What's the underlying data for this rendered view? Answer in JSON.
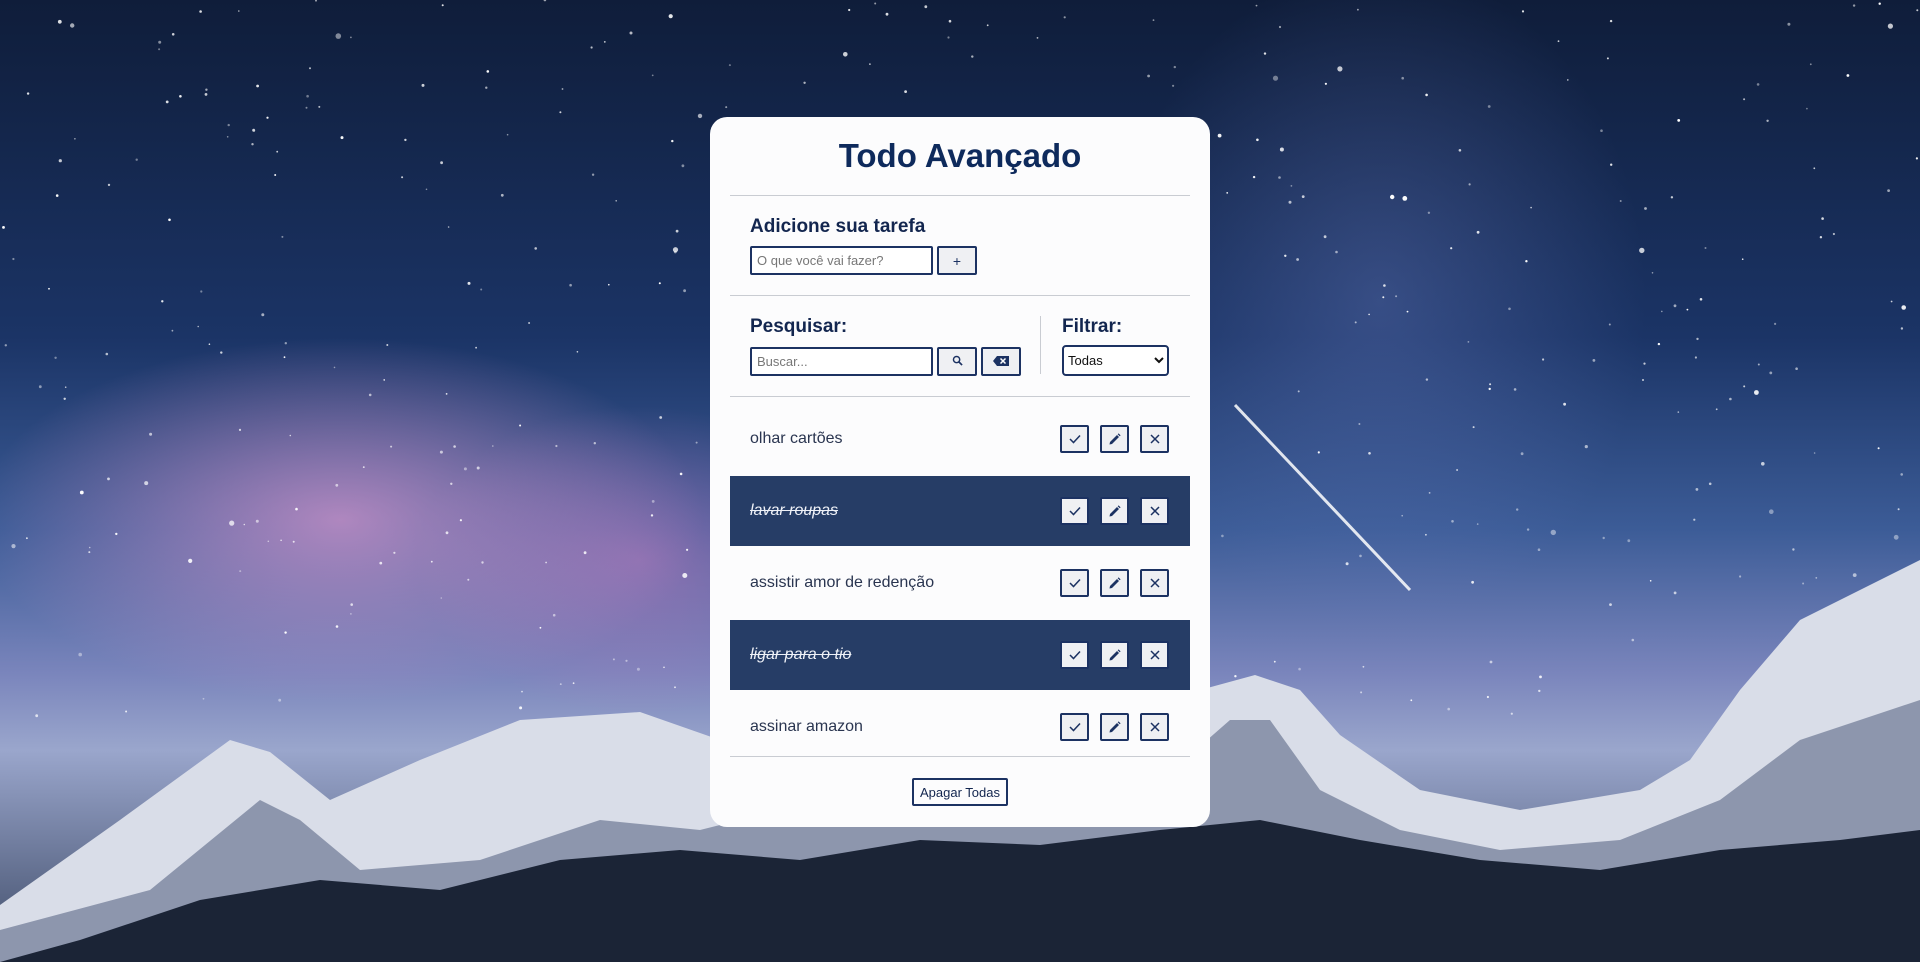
{
  "app": {
    "title": "Todo Avançado"
  },
  "add": {
    "label": "Adicione sua tarefa",
    "input_value": "",
    "input_placeholder": "O que você vai fazer?",
    "add_button_label": "+"
  },
  "search": {
    "label": "Pesquisar:",
    "input_value": "",
    "input_placeholder": "Buscar...",
    "search_icon": "search-icon",
    "clear_icon": "backspace-icon"
  },
  "filter": {
    "label": "Filtrar:",
    "selected": "Todas"
  },
  "todos": [
    {
      "text": "olhar cartões",
      "done": false
    },
    {
      "text": "lavar roupas",
      "done": true
    },
    {
      "text": "assistir amor de redenção",
      "done": false
    },
    {
      "text": "ligar para o tio",
      "done": true
    },
    {
      "text": "assinar amazon",
      "done": false
    }
  ],
  "todo_actions": {
    "finish_icon": "check-icon",
    "edit_icon": "pencil-icon",
    "remove_icon": "close-icon"
  },
  "footer": {
    "delete_all_label": "Apagar Todas"
  },
  "colors": {
    "primary": "#1c3262",
    "done_row": "#263d66",
    "title": "#0e2a5c",
    "card": "#fcfcfd"
  }
}
